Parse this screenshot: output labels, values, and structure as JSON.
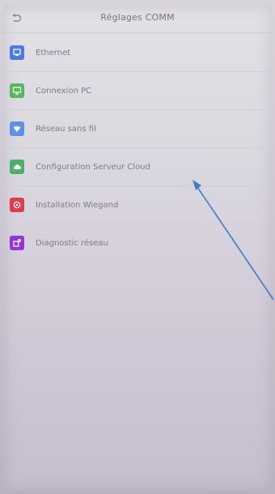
{
  "header": {
    "title": "Réglages COMM",
    "back_icon": "back-icon"
  },
  "menu": {
    "items": [
      {
        "label": "Ethernet",
        "icon": "ethernet-icon",
        "color": "#4f7be0"
      },
      {
        "label": "Connexion PC",
        "icon": "pc-connection-icon",
        "color": "#58b65f"
      },
      {
        "label": "Réseau sans fil",
        "icon": "wifi-icon",
        "color": "#5b92e4"
      },
      {
        "label": "Configuration Serveur Cloud",
        "icon": "cloud-icon",
        "color": "#4eaf66"
      },
      {
        "label": "Installation Wiegand",
        "icon": "wiegand-icon",
        "color": "#df3d4a"
      },
      {
        "label": "Diagnostic réseau",
        "icon": "network-diagnostic-icon",
        "color": "#8e38d8"
      }
    ]
  },
  "annotation": {
    "arrow_color": "#3f7fc7"
  }
}
